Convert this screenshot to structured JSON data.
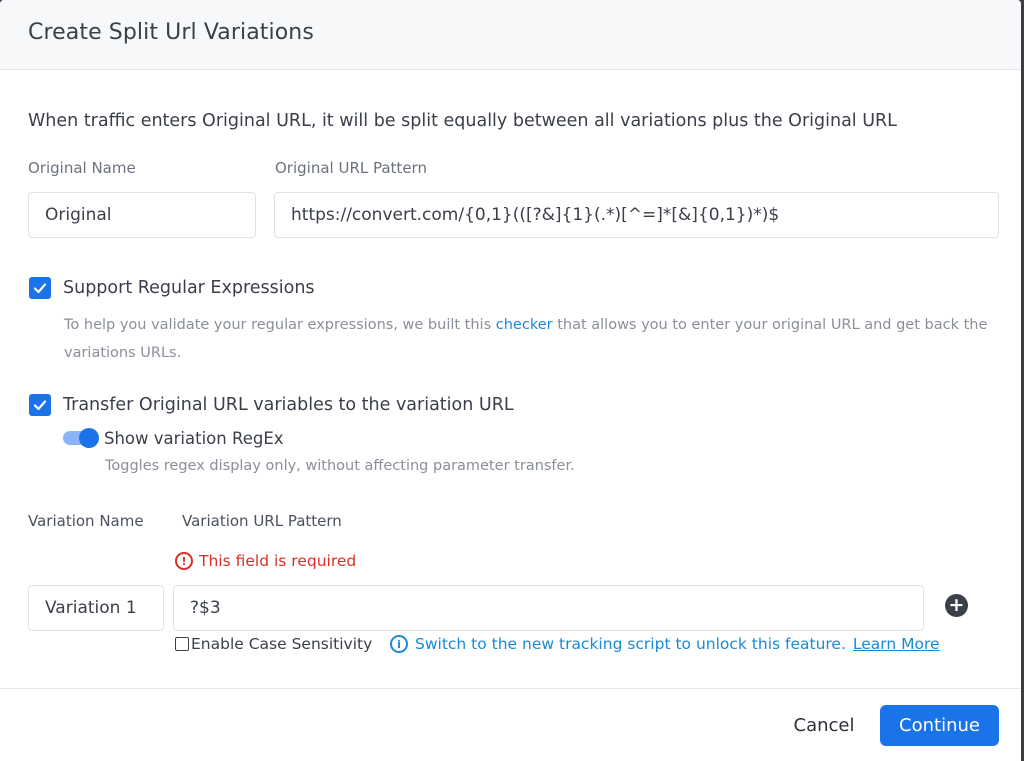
{
  "dialog": {
    "title": "Create Split Url Variations"
  },
  "description": "When traffic enters Original URL, it will be split equally between all variations plus the Original URL",
  "original": {
    "name_label": "Original Name",
    "url_label": "Original URL Pattern",
    "name_value": "Original",
    "url_value": "https://convert.com/{0,1}(([?&]{1}(.*)[^=]*[&]{0,1})*)$"
  },
  "regex": {
    "checked": true,
    "label": "Support Regular Expressions",
    "help_before": "To help you validate your regular expressions, we built this ",
    "help_link": "checker",
    "help_after": " that allows you to enter your original URL and get back the variations URLs."
  },
  "transfer": {
    "checked": true,
    "label": "Transfer Original URL variables to the variation URL",
    "toggle_on": true,
    "toggle_label": "Show variation RegEx",
    "toggle_help": "Toggles regex display only, without affecting parameter transfer."
  },
  "variation": {
    "name_label": "Variation Name",
    "url_label": "Variation URL Pattern",
    "error": "This field is required",
    "name_value": "Variation 1",
    "url_value": "?$3",
    "case_label": "Enable Case Sensitivity",
    "case_checked": false,
    "info_text": "Switch to the new tracking script to unlock this feature.",
    "learn_more": "Learn More"
  },
  "footer": {
    "cancel_label": "Cancel",
    "continue_label": "Continue"
  },
  "icons": {
    "check": "check-icon",
    "error": "alert-circle-icon",
    "info": "info-circle-icon",
    "add": "plus-circle-icon"
  },
  "colors": {
    "primary": "#1a73e8",
    "error": "#d93025",
    "info": "#1a8ad4"
  }
}
